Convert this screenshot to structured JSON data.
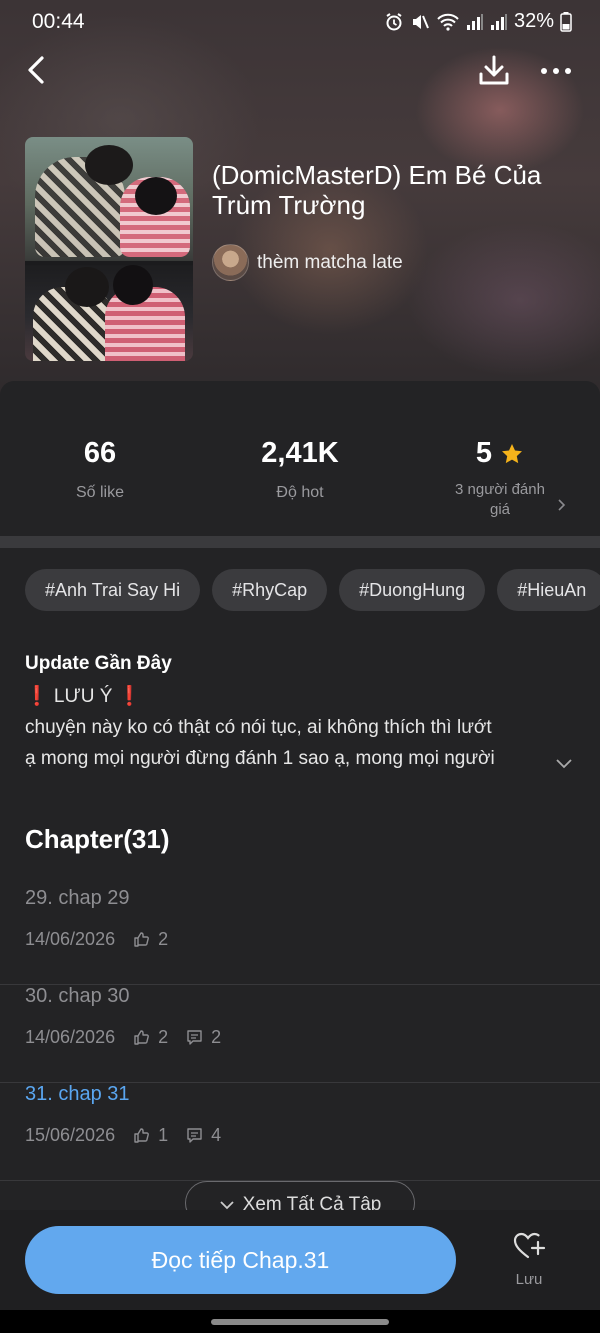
{
  "status_bar": {
    "time": "00:44",
    "battery": "32%"
  },
  "header": {
    "icons": {
      "back": "back-arrow-icon",
      "download": "download-icon",
      "more": "more-dots-icon"
    }
  },
  "story": {
    "title": "(DomicMasterD) Em Bé Của Trùm Trường",
    "author": "thèm matcha late"
  },
  "stats": {
    "likes": {
      "value": "66",
      "label": "Số like"
    },
    "hot": {
      "value": "2,41K",
      "label": "Độ hot"
    },
    "rating": {
      "value": "5",
      "label": "3 người đánh giá"
    }
  },
  "tags": [
    "#Anh Trai Say Hi",
    "#RhyCap",
    "#DuongHung",
    "#HieuAn"
  ],
  "update": {
    "title": "Update Gần Đây",
    "line1": "❗ LƯU Ý ❗",
    "line2": "chuyện này ko có thật có nói tục, ai không thích thì lướt",
    "line3": "ạ mong mọi người đừng đánh 1 sao ạ, mong mọi người"
  },
  "chapters": {
    "title": "Chapter(31)",
    "items": [
      {
        "name": "29. chap 29",
        "date": "14/06/2026",
        "likes": "2",
        "comments": ""
      },
      {
        "name": "30. chap 30",
        "date": "14/06/2026",
        "likes": "2",
        "comments": "2"
      },
      {
        "name": "31. chap 31",
        "date": "15/06/2026",
        "likes": "1",
        "comments": "4"
      }
    ],
    "see_all": "Xem Tất Cả Tập"
  },
  "bottom": {
    "read_button": "Đọc tiếp Chap.31",
    "save_label": "Lưu"
  },
  "colors": {
    "accent": "#62a8ee",
    "active_chapter": "#5aa6f0",
    "star": "#f5b31b",
    "sheet": "#232325"
  }
}
